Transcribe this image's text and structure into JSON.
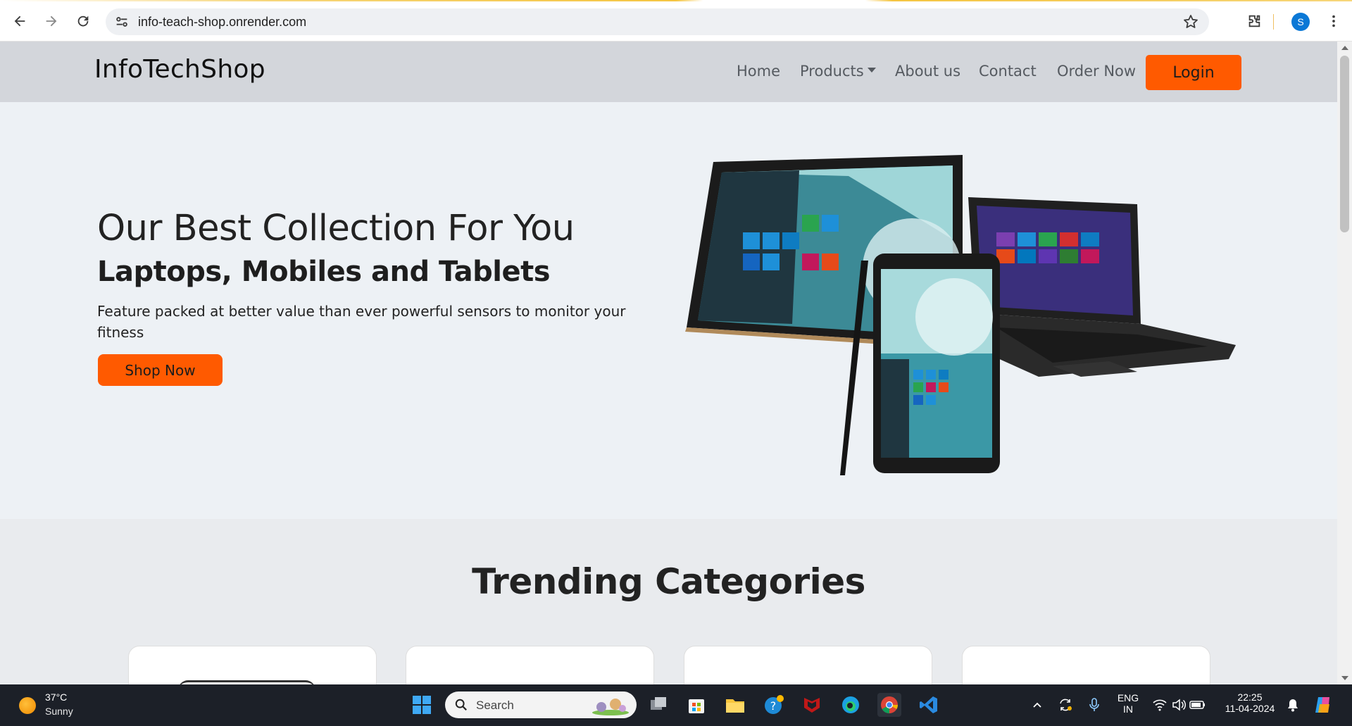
{
  "browser": {
    "url": "info-teach-shop.onrender.com",
    "profile_initial": "S",
    "icons": [
      "back-icon",
      "forward-icon",
      "reload-icon",
      "site-settings-icon",
      "bookmark-star-icon",
      "extensions-icon",
      "menu-icon"
    ]
  },
  "nav": {
    "brand": "InfoTechShop",
    "links": {
      "home": "Home",
      "products": "Products",
      "about": "About us",
      "contact": "Contact",
      "order": "Order Now"
    },
    "login_label": "Login"
  },
  "hero": {
    "title": "Our Best Collection For You",
    "subtitle": "Laptops, Mobiles and Tablets",
    "description": "Feature packed at better value than ever powerful sensors to monitor your fitness",
    "cta_label": "Shop Now"
  },
  "trending": {
    "title": "Trending Categories"
  },
  "taskbar": {
    "weather_temp": "37°C",
    "weather_condition": "Sunny",
    "search_placeholder": "Search",
    "lang_line1": "ENG",
    "lang_line2": "IN",
    "time": "22:25",
    "date": "11-04-2024"
  },
  "colors": {
    "accent": "#ff5a00",
    "navbar_bg": "#d3d6db",
    "hero_bg": "#edf1f5",
    "taskbar_bg": "#1c2028"
  }
}
